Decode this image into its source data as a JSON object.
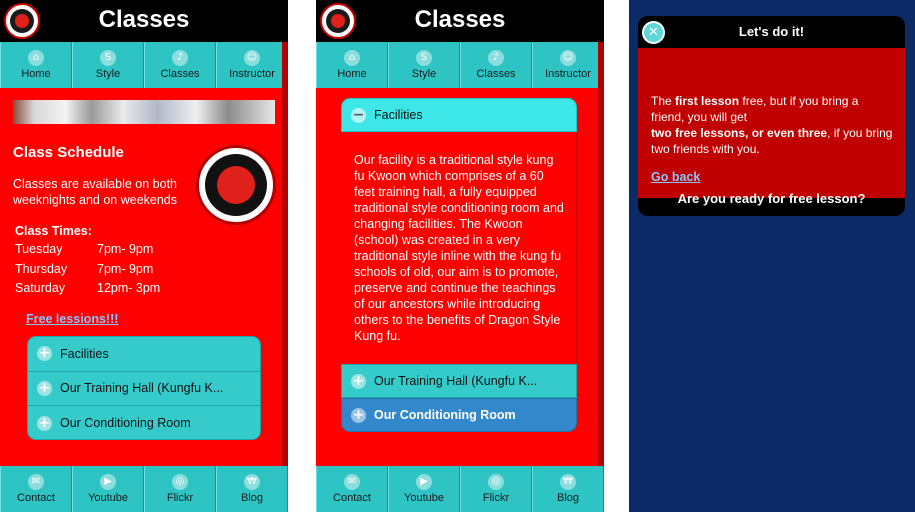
{
  "header": {
    "title": "Classes"
  },
  "top_nav": [
    {
      "label": "Home",
      "icon": "home-icon",
      "glyph": "⌂"
    },
    {
      "label": "Style",
      "icon": "style-icon",
      "glyph": "S"
    },
    {
      "label": "Classes",
      "icon": "bell-icon",
      "glyph": "♪"
    },
    {
      "label": "Instructor",
      "icon": "person-icon",
      "glyph": "☺"
    }
  ],
  "bottom_nav": [
    {
      "label": "Contact",
      "icon": "mail-icon",
      "glyph": "✉"
    },
    {
      "label": "Youtube",
      "icon": "youtube-icon",
      "glyph": "▶"
    },
    {
      "label": "Flickr",
      "icon": "camera-icon",
      "glyph": "◎"
    },
    {
      "label": "Blog",
      "icon": "blog-icon",
      "glyph": "₩"
    }
  ],
  "schedule": {
    "title": "Class Schedule",
    "description": "Classes are available on both weeknights and on weekends",
    "times_title": "Class Times:",
    "rows": [
      {
        "day": "Tuesday",
        "time": "7pm- 9pm"
      },
      {
        "day": "Thursday",
        "time": "7pm- 9pm"
      },
      {
        "day": "Saturday",
        "time": "12pm- 3pm"
      }
    ],
    "free_link": "Free lessions!!!"
  },
  "accordion": {
    "items": [
      "Facilities",
      "Our Training Hall (Kungfu K...",
      "Our Conditioning Room"
    ],
    "facilities_text": "Our facility is a traditional style kung fu Kwoon which comprises of a 60 feet training hall, a fully equipped traditional style conditioning room and changing facilities. The Kwoon (school) was created in a very traditional style inline with the kung fu schools of old, our aim is to promote, preserve and continue the teachings of our ancestors while introducing others to the benefits of Dragon Style Kung fu."
  },
  "dialog": {
    "title": "Let's do it!",
    "close_glyph": "✕",
    "msg_1": "The ",
    "msg_2": "first lesson",
    "msg_3": " free, but if you bring a friend, you will get",
    "msg_4": "two free lessons, or even three",
    "msg_5": ", if you bring two friends with you.",
    "back_link": "Go back",
    "footer": "Are you ready for free lesson?"
  },
  "colors": {
    "page_red": "#ff0000",
    "teal": "#2ec4c4",
    "active_blue": "#3388cc",
    "dialog_red": "#c00000",
    "backdrop": "#0b2a66"
  }
}
